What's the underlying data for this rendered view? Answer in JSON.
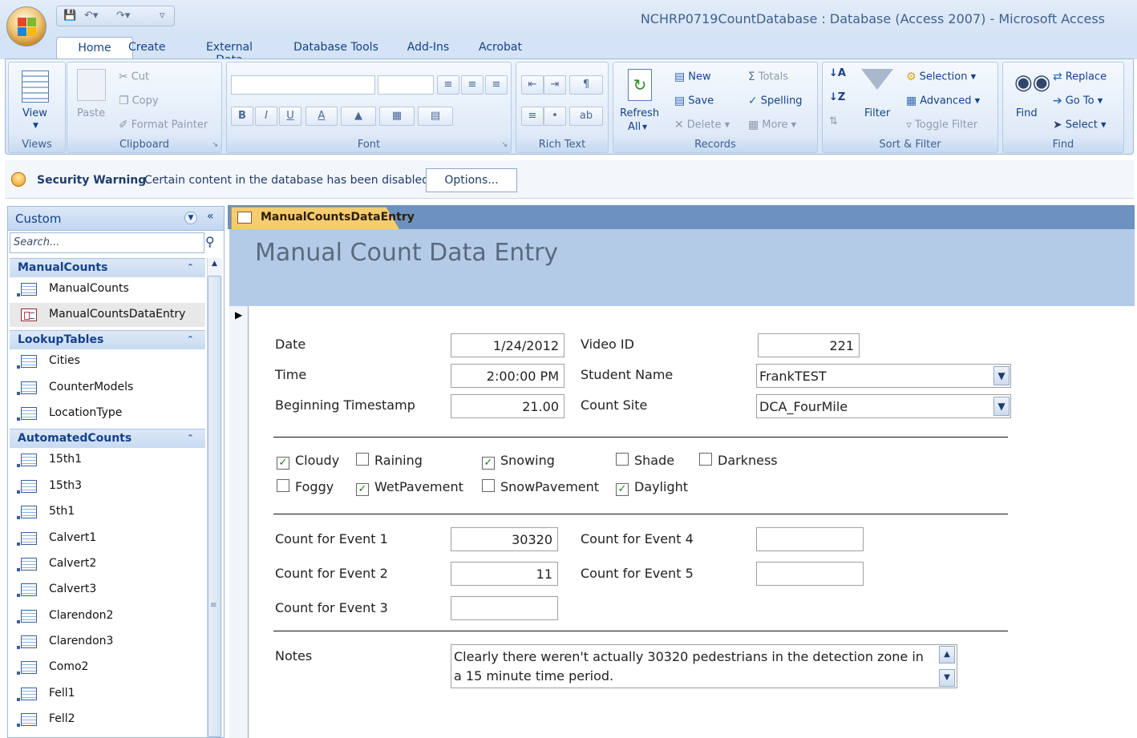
{
  "window": {
    "title": "NCHRP0719CountDatabase : Database (Access 2007) - Microsoft Access"
  },
  "ribbon_tabs": [
    "Home",
    "Create",
    "External Data",
    "Database Tools",
    "Add-Ins",
    "Acrobat"
  ],
  "ribbon": {
    "views": {
      "view_label": "View",
      "group_label": "Views"
    },
    "clipboard": {
      "paste": "Paste",
      "cut": "Cut",
      "copy": "Copy",
      "format_painter": "Format Painter",
      "group_label": "Clipboard"
    },
    "font": {
      "bold": "B",
      "italic": "I",
      "underline": "U",
      "font_color": "A",
      "group_label": "Font"
    },
    "rich_text": {
      "group_label": "Rich Text"
    },
    "records": {
      "refresh": "Refresh",
      "refresh_all": "All",
      "new": "New",
      "save": "Save",
      "delete": "Delete",
      "totals": "Totals",
      "spelling": "Spelling",
      "more": "More",
      "group_label": "Records"
    },
    "sort_filter": {
      "filter": "Filter",
      "selection": "Selection",
      "advanced": "Advanced",
      "toggle_filter": "Toggle Filter",
      "group_label": "Sort & Filter"
    },
    "find": {
      "find": "Find",
      "replace": "Replace",
      "go_to": "Go To",
      "select": "Select",
      "group_label": "Find"
    }
  },
  "security_bar": {
    "title": "Security Warning",
    "message": "Certain content in the database has been disabled",
    "options_button": "Options..."
  },
  "nav_pane": {
    "title": "Custom",
    "search_placeholder": "Search...",
    "groups": [
      {
        "name": "ManualCounts",
        "items": [
          {
            "label": "ManualCounts",
            "type": "table"
          },
          {
            "label": "ManualCountsDataEntry",
            "type": "form",
            "selected": true
          }
        ]
      },
      {
        "name": "LookupTables",
        "items": [
          {
            "label": "Cities",
            "type": "table"
          },
          {
            "label": "CounterModels",
            "type": "table"
          },
          {
            "label": "LocationType",
            "type": "table"
          }
        ]
      },
      {
        "name": "AutomatedCounts",
        "items": [
          {
            "label": "15th1",
            "type": "table"
          },
          {
            "label": "15th3",
            "type": "table"
          },
          {
            "label": "5th1",
            "type": "table"
          },
          {
            "label": "Calvert1",
            "type": "table"
          },
          {
            "label": "Calvert2",
            "type": "table"
          },
          {
            "label": "Calvert3",
            "type": "table"
          },
          {
            "label": "Clarendon2",
            "type": "table"
          },
          {
            "label": "Clarendon3",
            "type": "table"
          },
          {
            "label": "Como2",
            "type": "table"
          },
          {
            "label": "Fell1",
            "type": "table"
          },
          {
            "label": "Fell2",
            "type": "table"
          }
        ]
      }
    ]
  },
  "document_tab": {
    "label": "ManualCountsDataEntry"
  },
  "form": {
    "title": "Manual Count Data Entry",
    "fields": {
      "date": {
        "label": "Date",
        "value": "1/24/2012"
      },
      "time": {
        "label": "Time",
        "value": "2:00:00 PM"
      },
      "beginning_timestamp": {
        "label": "Beginning Timestamp",
        "value": "21.00"
      },
      "video_id": {
        "label": "Video ID",
        "value": "221"
      },
      "student_name": {
        "label": "Student Name",
        "value": "FrankTEST"
      },
      "count_site": {
        "label": "Count Site",
        "value": "DCA_FourMile"
      }
    },
    "conditions": [
      {
        "label": "Cloudy",
        "checked": true
      },
      {
        "label": "Raining",
        "checked": false
      },
      {
        "label": "Snowing",
        "checked": true
      },
      {
        "label": "Shade",
        "checked": false
      },
      {
        "label": "Darkness",
        "checked": false
      },
      {
        "label": "Foggy",
        "checked": false
      },
      {
        "label": "WetPavement",
        "checked": true
      },
      {
        "label": "SnowPavement",
        "checked": false
      },
      {
        "label": "Daylight",
        "checked": true
      }
    ],
    "counts": {
      "event1": {
        "label": "Count for Event 1",
        "value": "30320"
      },
      "event2": {
        "label": "Count for Event 2",
        "value": "11"
      },
      "event3": {
        "label": "Count for Event 3",
        "value": ""
      },
      "event4": {
        "label": "Count for Event 4",
        "value": ""
      },
      "event5": {
        "label": "Count for Event 5",
        "value": ""
      }
    },
    "notes": {
      "label": "Notes",
      "value": "Clearly there weren't actually 30320 pedestrians in the detection zone in a 15 minute time period."
    }
  }
}
